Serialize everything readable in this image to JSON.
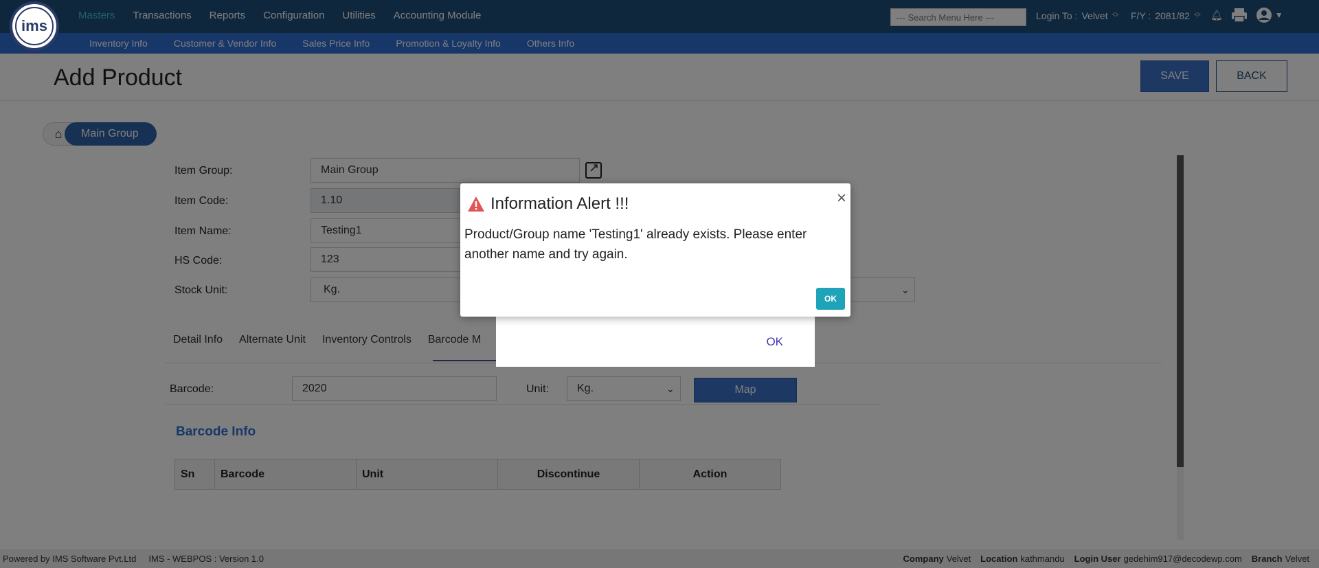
{
  "logo": {
    "text": "ims"
  },
  "nav": {
    "menu": [
      "Masters",
      "Transactions",
      "Reports",
      "Configuration",
      "Utilities",
      "Accounting Module"
    ],
    "search_placeholder": "--- Search Menu Here ---",
    "login_label": "Login To :",
    "login_value": "Velvet",
    "fy_label": "F/Y :",
    "fy_value": "2081/82",
    "submenu": [
      "Inventory Info",
      "Customer & Vendor Info",
      "Sales Price Info",
      "Promotion & Loyalty Info",
      "Others Info"
    ]
  },
  "page": {
    "title": "Add Product",
    "save_label": "SAVE",
    "back_label": "BACK",
    "breadcrumb": "Main Group"
  },
  "form": {
    "item_group_label": "Item Group:",
    "item_group_value": "Main Group",
    "item_code_label": "Item Code:",
    "item_code_value": "1.10",
    "item_name_label": "Item Name:",
    "item_name_value": "Testing1",
    "hs_code_label": "HS Code:",
    "hs_code_value": "123",
    "stock_unit_label": "Stock Unit:",
    "stock_unit_value": "Kg."
  },
  "tabs": [
    "Detail Info",
    "Alternate Unit",
    "Inventory Controls",
    "Barcode M"
  ],
  "barcode": {
    "barcode_label": "Barcode:",
    "barcode_value": "2020",
    "unit_label": "Unit:",
    "unit_value": "Kg.",
    "map_label": "Map",
    "section_title": "Barcode Info",
    "columns": [
      "Sn",
      "Barcode",
      "Unit",
      "Discontinue",
      "Action"
    ]
  },
  "footer": {
    "powered": "Powered by IMS Software Pvt.Ltd",
    "version": "IMS - WEBPOS : Version 1.0",
    "company_label": "Company",
    "company_value": "Velvet",
    "location_label": "Location",
    "location_value": "kathmandu",
    "user_label": "Login User",
    "user_value": "gedehim917@decodewp.com",
    "branch_label": "Branch",
    "branch_value": "Velvet"
  },
  "back_dialog": {
    "ok_label": "OK"
  },
  "alert": {
    "title": "Information Alert !!!",
    "message": "Product/Group name 'Testing1' already exists. Please enter another name and try again.",
    "ok_label": "OK",
    "close_symbol": "×"
  },
  "colors": {
    "nav": "#1f4e7a",
    "subnav": "#2e6fd3",
    "accent": "#1ea3b8",
    "warning": "#e05555"
  }
}
